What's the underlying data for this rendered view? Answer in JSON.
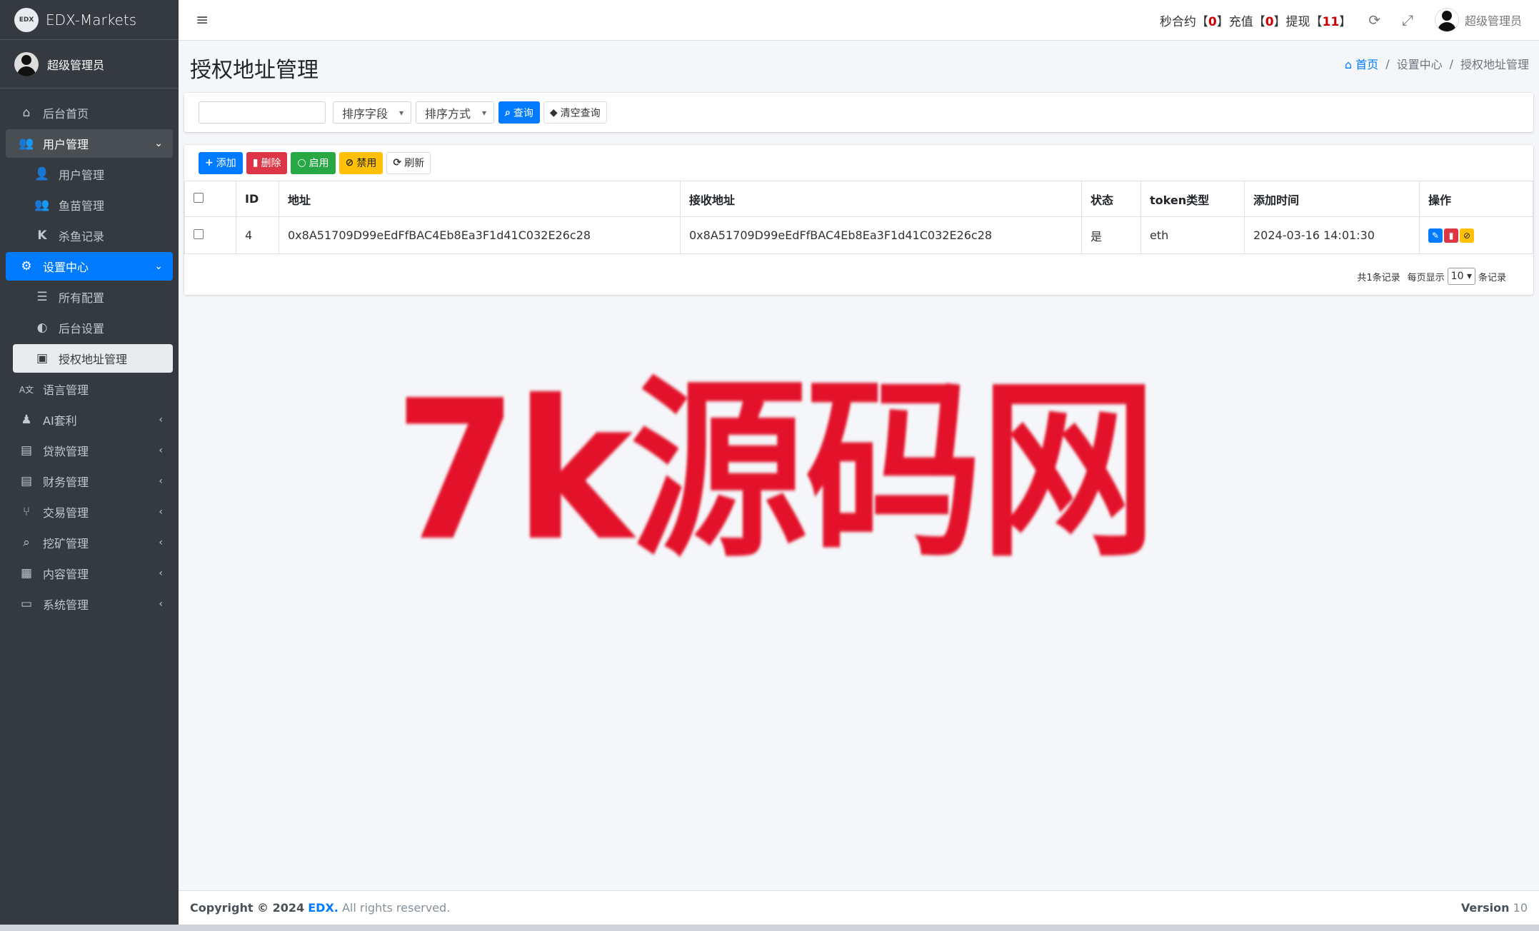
{
  "brand": {
    "logo_text": "EDX",
    "name": "EDX-Markets"
  },
  "sidebar_user": {
    "name": "超级管理员"
  },
  "nav": {
    "home": "后台首页",
    "user_mgmt": "用户管理",
    "user_mgmt_sub": "用户管理",
    "fish_mgmt": "鱼苗管理",
    "kill_fish": "杀鱼记录",
    "settings": "设置中心",
    "all_config": "所有配置",
    "backend_settings": "后台设置",
    "auth_address": "授权地址管理",
    "language": "语言管理",
    "ai_arbitrage": "AI套利",
    "loan": "贷款管理",
    "finance": "财务管理",
    "trade": "交易管理",
    "mining": "挖矿管理",
    "content": "内容管理",
    "system": "系统管理"
  },
  "topbar": {
    "stats_prefix1": "秒合约【",
    "stats_val1": "0",
    "stats_prefix2": "】充值【",
    "stats_val2": "0",
    "stats_prefix3": "】提现【",
    "stats_val3": "11",
    "stats_suffix": "】",
    "admin_name": "超级管理员"
  },
  "page": {
    "title": "授权地址管理",
    "breadcrumb": [
      "首页",
      "设置中心",
      "授权地址管理"
    ]
  },
  "search": {
    "input_value": "",
    "sort_field": "排序字段",
    "sort_order": "排序方式",
    "query_btn": "查询",
    "clear_btn": "清空查询"
  },
  "toolbar": {
    "add": "添加",
    "delete": "删除",
    "enable": "启用",
    "disable": "禁用",
    "refresh": "刷新"
  },
  "table": {
    "headers": [
      "ID",
      "地址",
      "接收地址",
      "状态",
      "token类型",
      "添加时间",
      "操作"
    ],
    "rows": [
      {
        "id": "4",
        "address": "0x8A51709D99eEdFfBAC4Eb8Ea3F1d41C032E26c28",
        "receive_address": "0x8A51709D99eEdFfBAC4Eb8Ea3F1d41C032E26c28",
        "status": "是",
        "token_type": "eth",
        "created_at": "2024-03-16 14:01:30"
      }
    ]
  },
  "pager": {
    "total": "共1条记录",
    "per_page_label": "每页显示",
    "per_page_value": "10",
    "records_label": "条记录"
  },
  "watermark": "7k源码网",
  "footer": {
    "copyright_prefix": "Copyright © 2024",
    "brand": "EDX.",
    "rights": "All rights reserved.",
    "version_label": "Version",
    "version_value": "10"
  },
  "colors": {
    "sidebar_bg": "#343a40",
    "primary": "#007bff",
    "danger": "#dc3545",
    "success": "#28a745",
    "warning": "#ffc107",
    "watermark": "#e3122a"
  }
}
